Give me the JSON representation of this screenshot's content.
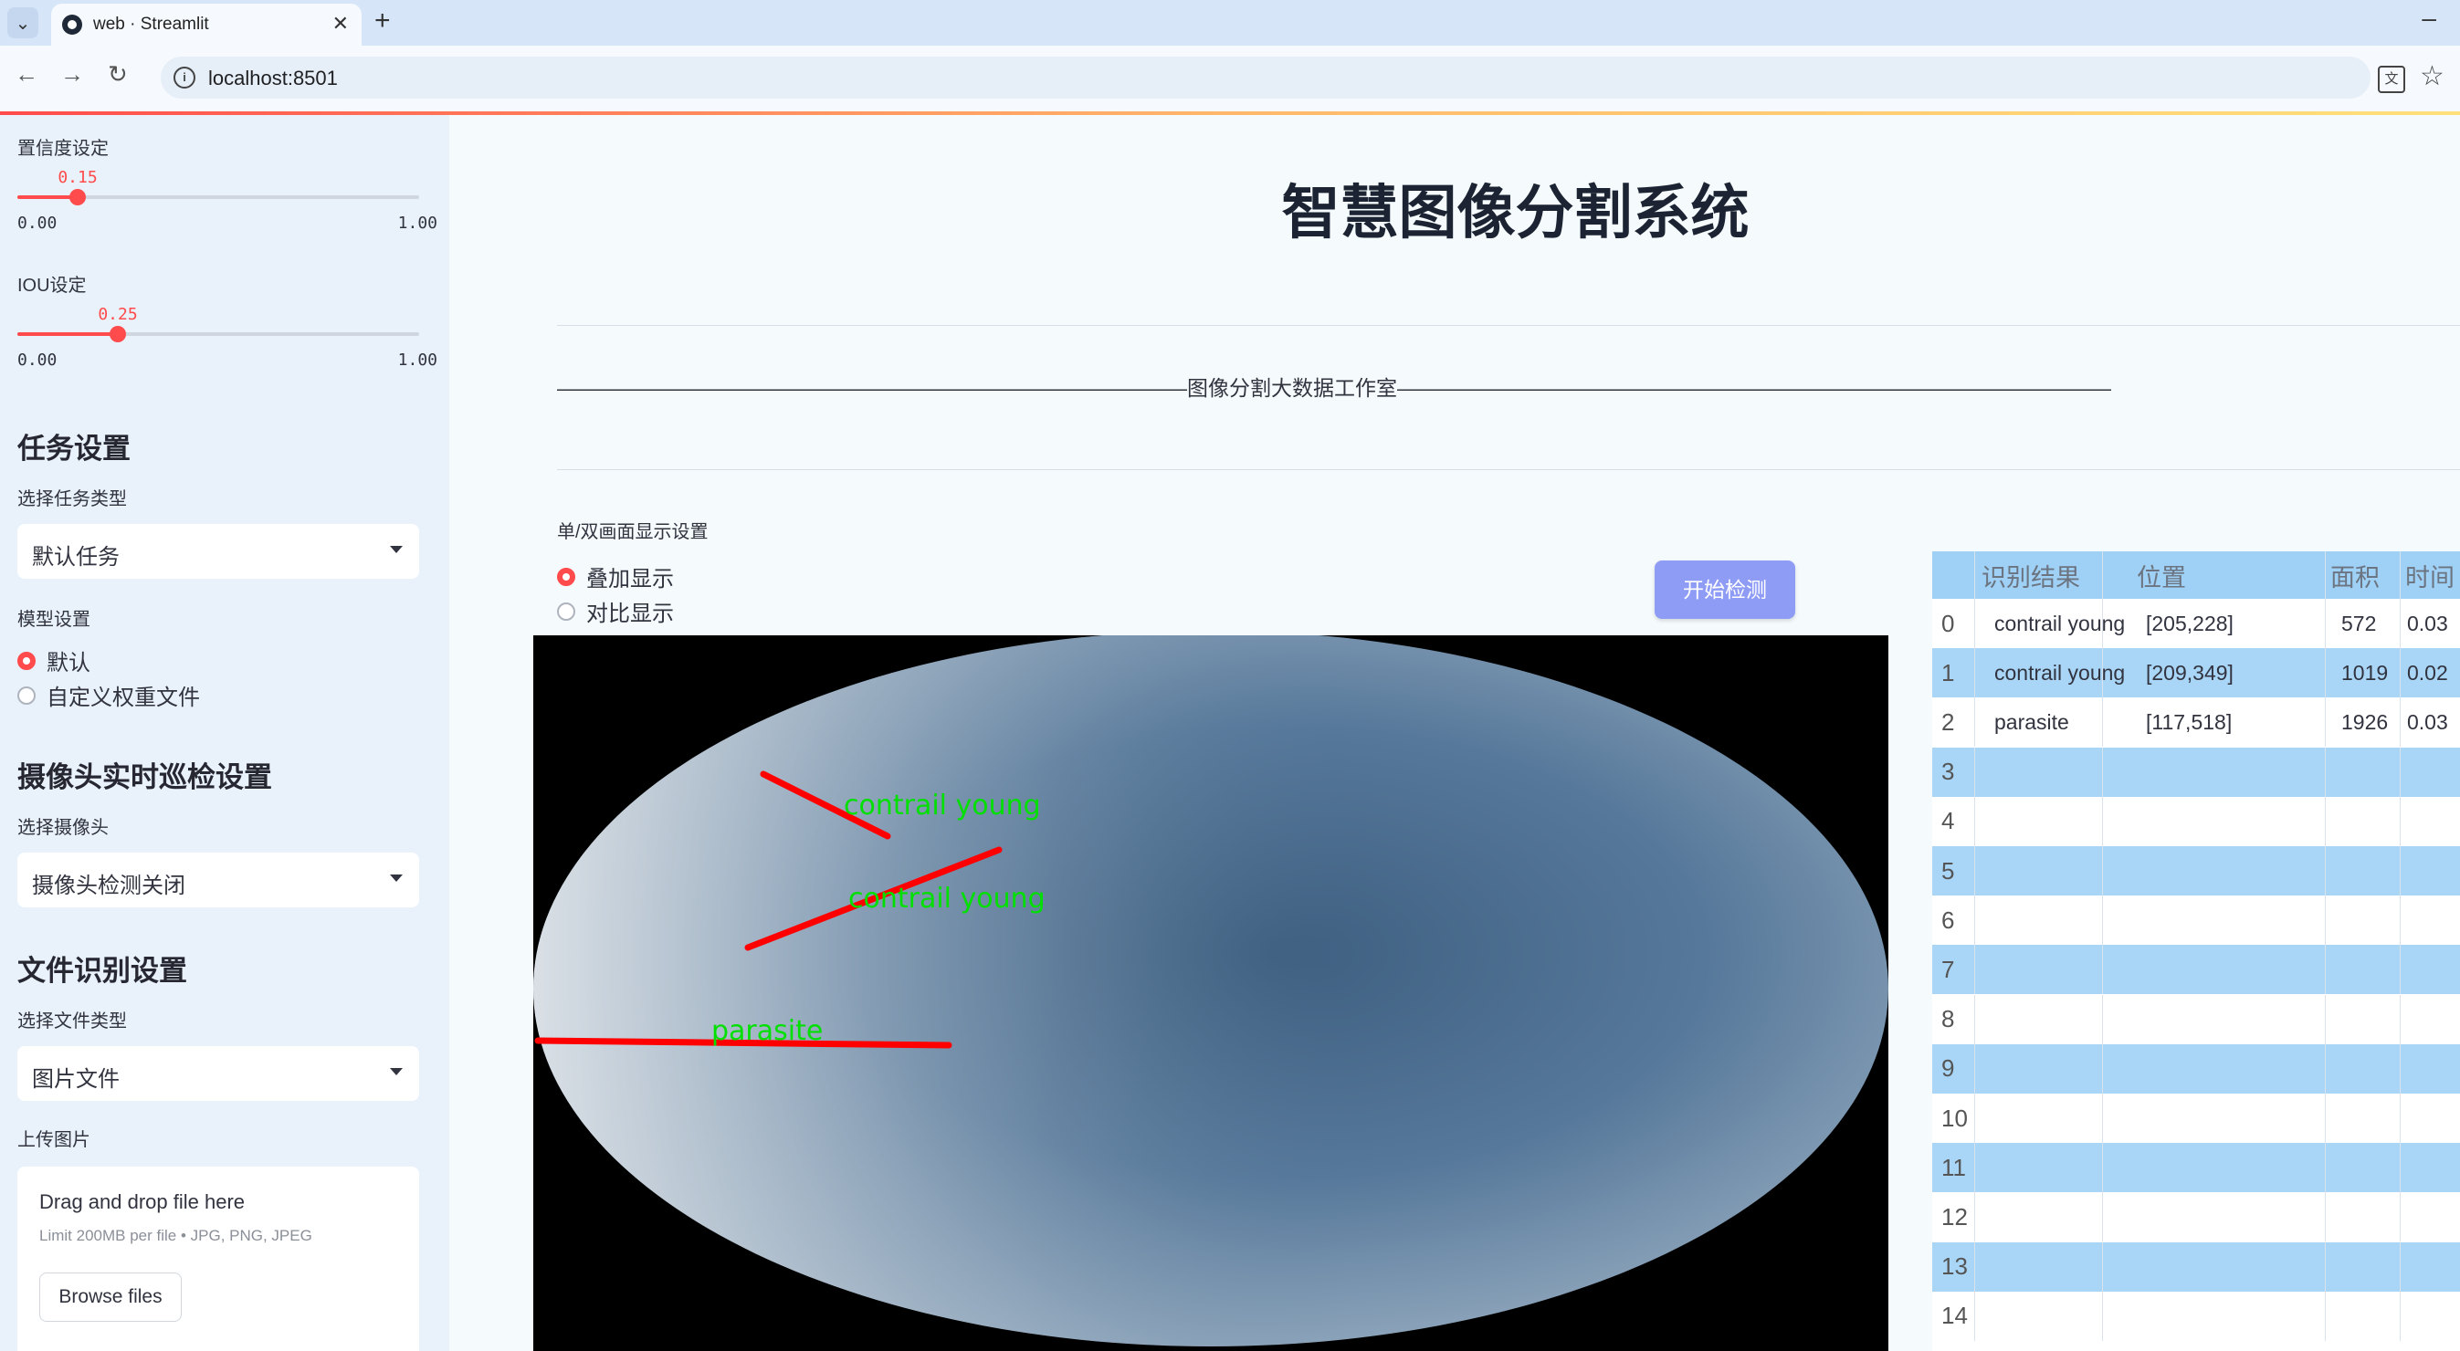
{
  "browser": {
    "tab_title": "web · Streamlit",
    "url": "localhost:8501"
  },
  "sidebar": {
    "confidence": {
      "label": "置信度设定",
      "value": "0.15",
      "value_num": 0.15,
      "min": "0.00",
      "max": "1.00"
    },
    "iou": {
      "label": "IOU设定",
      "value": "0.25",
      "value_num": 0.25,
      "min": "0.00",
      "max": "1.00"
    },
    "task": {
      "heading": "任务设置",
      "select_label": "选择任务类型",
      "selected": "默认任务"
    },
    "model": {
      "label": "模型设置",
      "options": [
        "默认",
        "自定义权重文件"
      ],
      "selected_index": 0
    },
    "camera": {
      "heading": "摄像头实时巡检设置",
      "select_label": "选择摄像头",
      "selected": "摄像头检测关闭"
    },
    "file": {
      "heading": "文件识别设置",
      "select_label": "选择文件类型",
      "selected": "图片文件",
      "upload_label": "上传图片"
    },
    "uploader": {
      "title": "Drag and drop file here",
      "limit": "Limit 200MB per file • JPG, PNG, JPEG",
      "button": "Browse files"
    }
  },
  "main": {
    "title": "智慧图像分割系统",
    "studio": "——————————————————————————————图像分割大数据工作室——————————————————————————————————",
    "display_label": "单/双画面显示设置",
    "display_options": [
      "叠加显示",
      "对比显示"
    ],
    "display_selected": 0,
    "detect_button": "开始检测"
  },
  "detections_overlay": [
    {
      "label": "contrail young",
      "color": "#ff0000",
      "text_color": "#00e000"
    },
    {
      "label": "contrail young",
      "color": "#ff0000",
      "text_color": "#00e000"
    },
    {
      "label": "parasite",
      "color": "#ff0000",
      "text_color": "#00e000"
    }
  ],
  "table": {
    "headers": [
      "",
      "识别结果",
      "位置",
      "面积",
      "时间"
    ],
    "rows": [
      {
        "idx": "0",
        "result": "contrail young",
        "position": "[205,228]",
        "area": "572",
        "time": "0.03"
      },
      {
        "idx": "1",
        "result": "contrail young",
        "position": "[209,349]",
        "area": "1019",
        "time": "0.02"
      },
      {
        "idx": "2",
        "result": "parasite",
        "position": "[117,518]",
        "area": "1926",
        "time": "0.03"
      },
      {
        "idx": "3",
        "result": "",
        "position": "",
        "area": "",
        "time": ""
      },
      {
        "idx": "4",
        "result": "",
        "position": "",
        "area": "",
        "time": ""
      },
      {
        "idx": "5",
        "result": "",
        "position": "",
        "area": "",
        "time": ""
      },
      {
        "idx": "6",
        "result": "",
        "position": "",
        "area": "",
        "time": ""
      },
      {
        "idx": "7",
        "result": "",
        "position": "",
        "area": "",
        "time": ""
      },
      {
        "idx": "8",
        "result": "",
        "position": "",
        "area": "",
        "time": ""
      },
      {
        "idx": "9",
        "result": "",
        "position": "",
        "area": "",
        "time": ""
      },
      {
        "idx": "10",
        "result": "",
        "position": "",
        "area": "",
        "time": ""
      },
      {
        "idx": "11",
        "result": "",
        "position": "",
        "area": "",
        "time": ""
      },
      {
        "idx": "12",
        "result": "",
        "position": "",
        "area": "",
        "time": ""
      },
      {
        "idx": "13",
        "result": "",
        "position": "",
        "area": "",
        "time": ""
      },
      {
        "idx": "14",
        "result": "",
        "position": "",
        "area": "",
        "time": ""
      }
    ]
  },
  "colors": {
    "accent": "#ff4b4b",
    "button": "#8f9cf6",
    "table_header": "#9fd0f5",
    "table_alt": "#a9d6f7",
    "sidebar_bg": "#e9f2fb"
  }
}
